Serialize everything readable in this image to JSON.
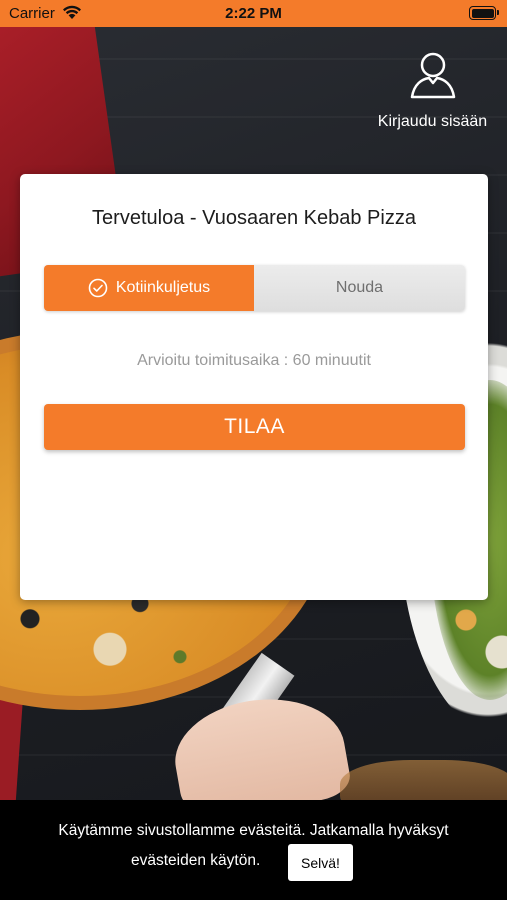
{
  "status_bar": {
    "carrier": "Carrier",
    "time": "2:22 PM",
    "icons": [
      "wifi-icon",
      "battery-icon"
    ]
  },
  "login": {
    "label": "Kirjaudu sisään",
    "icon": "user-icon"
  },
  "card": {
    "title": "Tervetuloa - Vuosaaren Kebab Pizza",
    "delivery_options": [
      {
        "label": "Kotiinkuljetus",
        "selected": true,
        "icon": "check-circle-icon"
      },
      {
        "label": "Nouda",
        "selected": false
      }
    ],
    "eta_text": "Arvioitu toimitusaika : 60 minuutit",
    "order_button": "TILAA"
  },
  "cookie_banner": {
    "line1": "Käytämme sivustollamme evästeitä. Jatkamalla hyväksyt",
    "line2": "evästeiden käytön.",
    "accept_label": "Selvä!"
  },
  "colors": {
    "accent": "#f47b2a",
    "card_bg": "#ffffff",
    "cookie_bg": "#000000",
    "muted_text": "#9a9a9a"
  }
}
